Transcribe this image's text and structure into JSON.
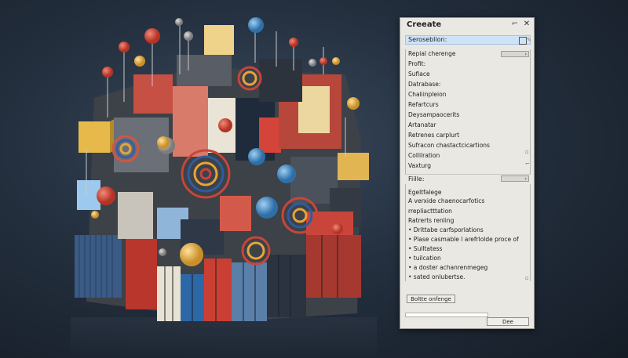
{
  "dialog": {
    "title": "Creeate",
    "icons": {
      "min": "restore-icon",
      "close": "close-icon"
    },
    "search": {
      "label": "Seroseblion:",
      "icon1": "copy-icon",
      "icon2": "pin-icon"
    },
    "section1": [
      "Repial cherenge",
      "Profit:",
      "Sufiace",
      "Datrabase:",
      "Chaliinpleion",
      "Refartcurs",
      "Deysampaocerits",
      "Artanatar",
      "Retrenes carplurt",
      "Sufracon chastactcicartions",
      "Collilration",
      "Vaxturg"
    ],
    "files_label": "Fiille:",
    "section2": [
      "Egeltfalege",
      "A verxide chaenocarfotics",
      "rrepliactttation",
      "Ratrerts renling",
      "• Drittabe carfsporlations",
      "• Plase casmable l arefrlolde proce of",
      "• Sulltatess",
      "• tuilcation",
      "• a doster achanrenmegeg",
      "• sated onlubertse."
    ],
    "action_button": "Boltte onfenge",
    "done_button": "Dee"
  }
}
